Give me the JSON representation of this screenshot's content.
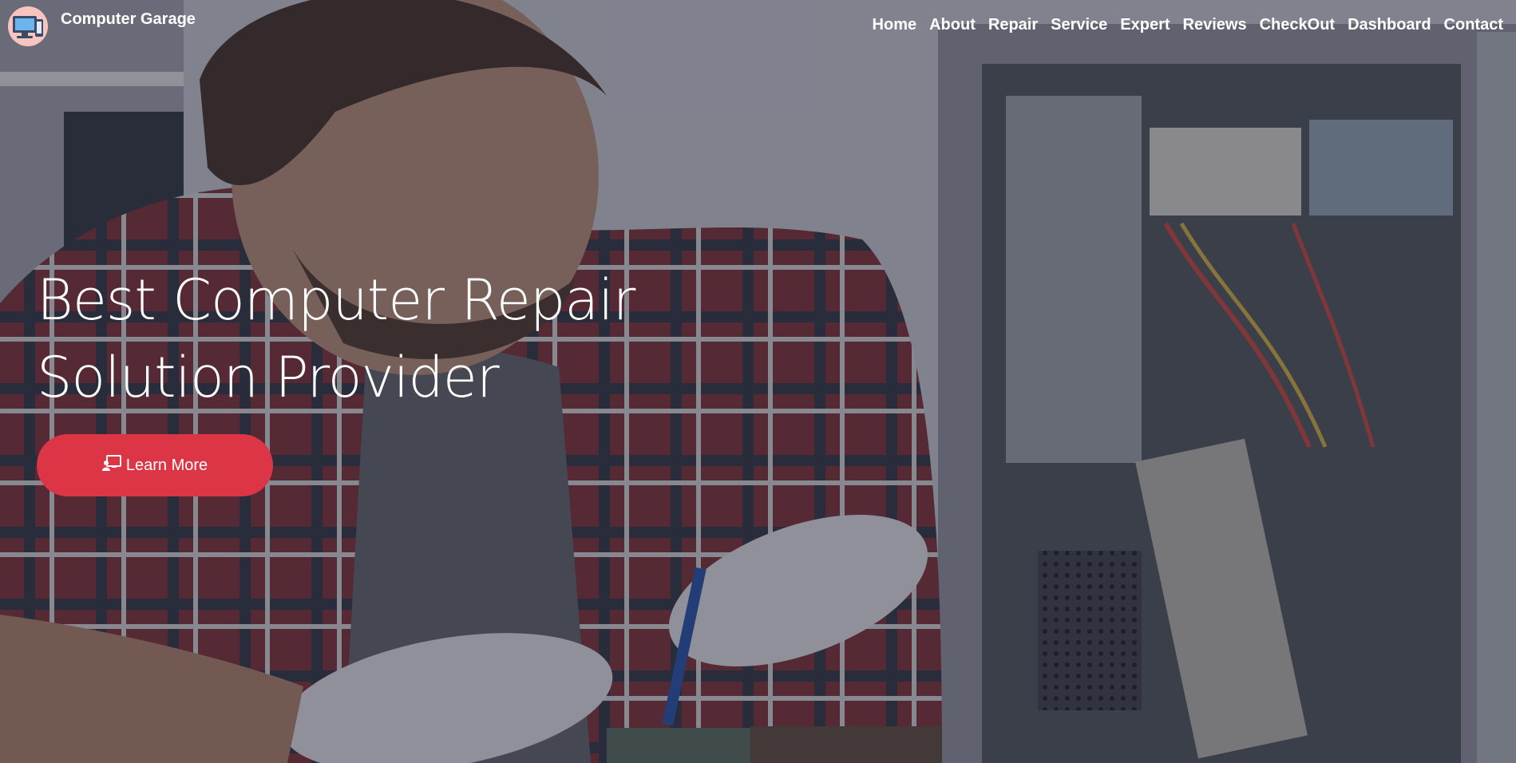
{
  "brand": {
    "name": "Computer Garage",
    "logo_icon": "computer-devices-icon"
  },
  "nav": {
    "items": [
      {
        "label": "Home"
      },
      {
        "label": "About"
      },
      {
        "label": "Repair"
      },
      {
        "label": "Service"
      },
      {
        "label": "Expert"
      },
      {
        "label": "Reviews"
      },
      {
        "label": "CheckOut"
      },
      {
        "label": "Dashboard"
      },
      {
        "label": "Contact"
      }
    ]
  },
  "hero": {
    "title_line1": "Best Computer Repair",
    "title_line2": "Solution Provider",
    "cta_label": "Learn More",
    "cta_icon": "chalkboard-teacher-icon",
    "background": "technician-repairing-computer-photo"
  },
  "colors": {
    "accent": "#dc3545",
    "text": "#ffffff",
    "logo_bg": "#f7c4bf"
  }
}
